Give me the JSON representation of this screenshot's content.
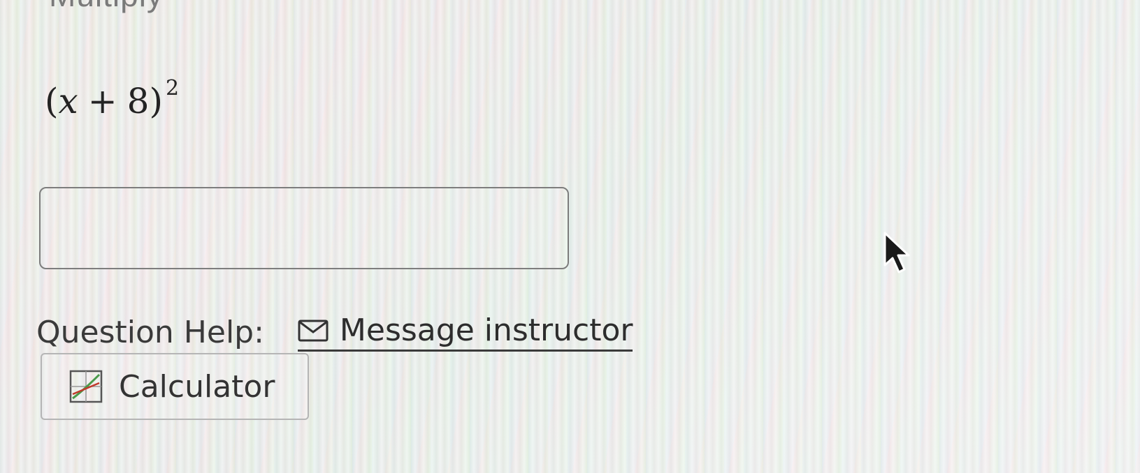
{
  "question": {
    "expression": {
      "open_paren": "(",
      "variable": "x",
      "operator": "+",
      "constant": "8",
      "close_paren": ")",
      "exponent": "2"
    },
    "answer_value": ""
  },
  "help": {
    "label": "Question Help:",
    "message_link": "Message instructor",
    "message_icon": "envelope-icon"
  },
  "calculator": {
    "label": "Calculator",
    "icon": "calculator-graph-icon"
  },
  "colors": {
    "text": "#2f2f2f",
    "border": "#7d7d7d",
    "icon_green": "#4a9a4a",
    "icon_red": "#c0392b"
  }
}
